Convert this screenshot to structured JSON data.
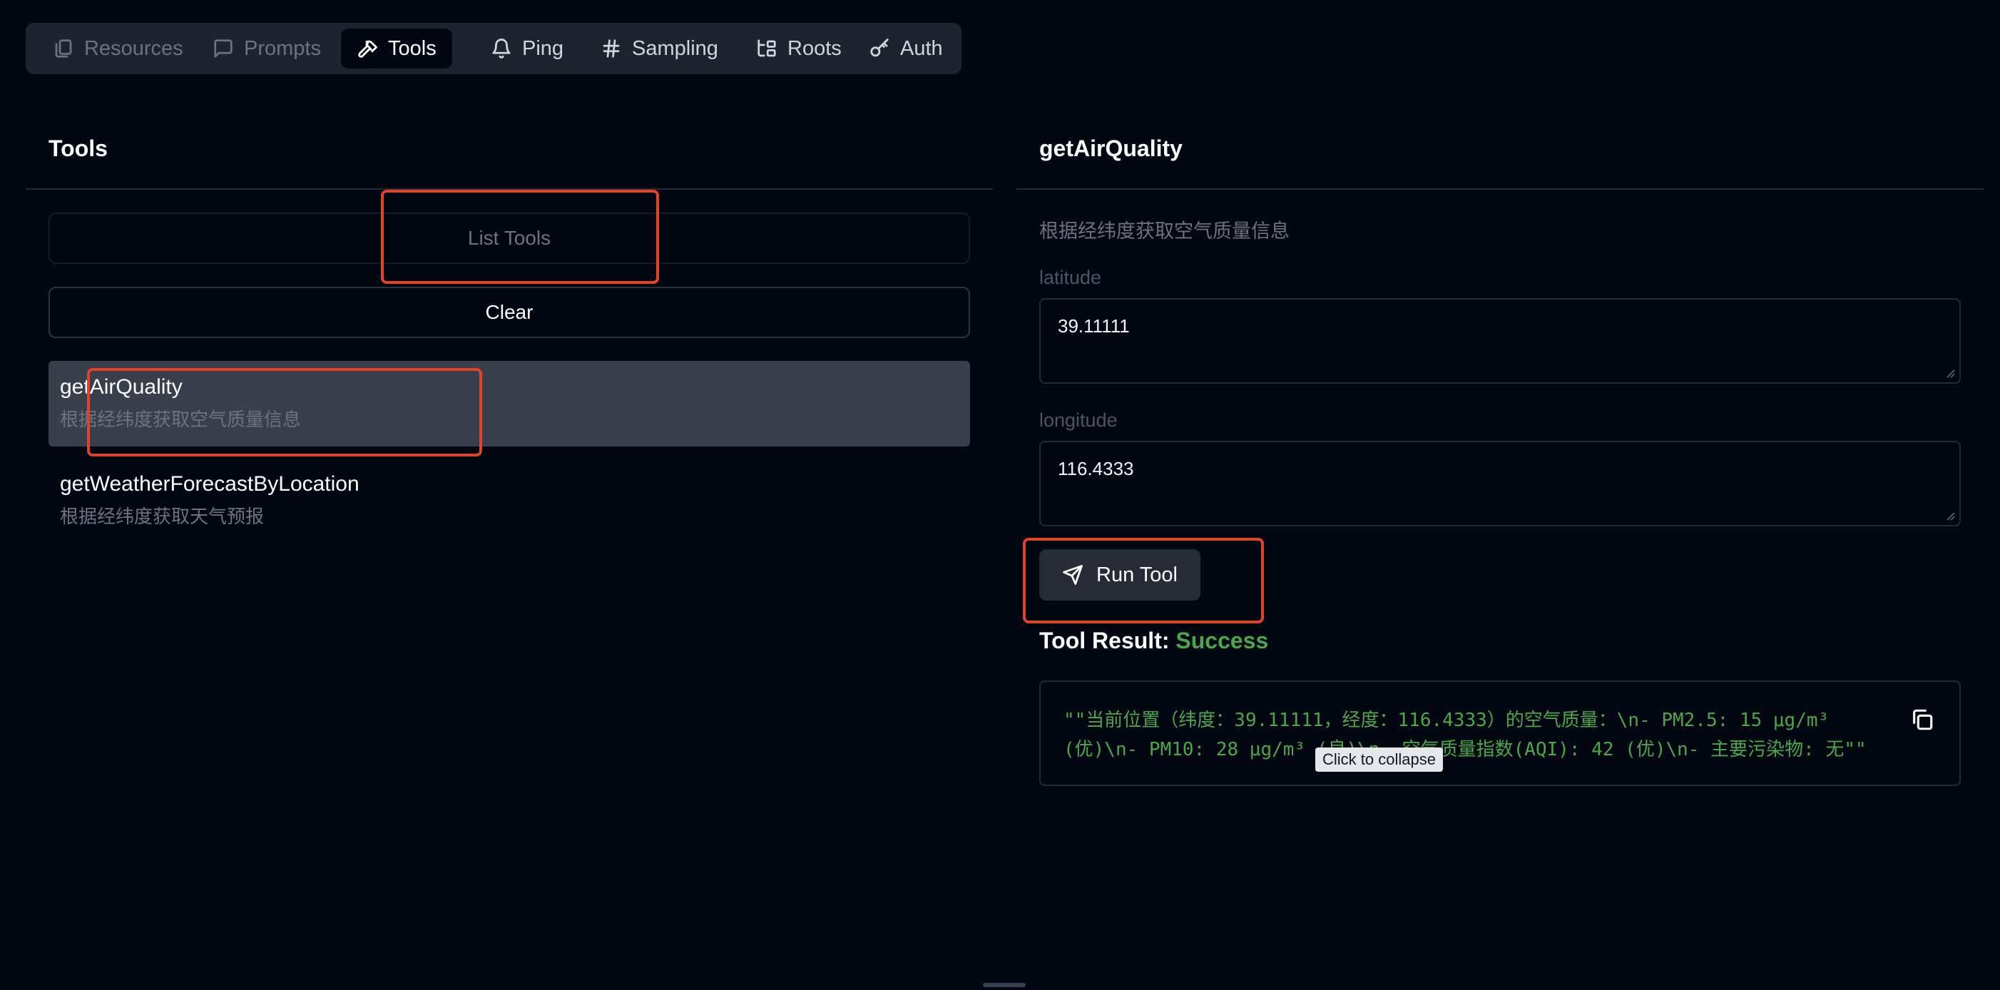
{
  "tabs": [
    {
      "label": "Resources",
      "icon": "files-icon"
    },
    {
      "label": "Prompts",
      "icon": "message-square-icon"
    },
    {
      "label": "Tools",
      "icon": "hammer-icon"
    },
    {
      "label": "Ping",
      "icon": "bell-icon"
    },
    {
      "label": "Sampling",
      "icon": "hash-icon"
    },
    {
      "label": "Roots",
      "icon": "folder-tree-icon"
    },
    {
      "label": "Auth",
      "icon": "key-icon"
    }
  ],
  "active_tab": "Tools",
  "left_panel": {
    "title": "Tools",
    "list_button": "List Tools",
    "clear_button": "Clear",
    "tools": [
      {
        "name": "getAirQuality",
        "description": "根据经纬度获取空气质量信息",
        "selected": true
      },
      {
        "name": "getWeatherForecastByLocation",
        "description": "根据经纬度获取天气预报",
        "selected": false
      }
    ]
  },
  "right_panel": {
    "title": "getAirQuality",
    "description": "根据经纬度获取空气质量信息",
    "fields": [
      {
        "label": "latitude",
        "value": "39.11111"
      },
      {
        "label": "longitude",
        "value": "116.4333"
      }
    ],
    "run_button": "Run Tool",
    "result_label": "Tool Result:",
    "result_status": "Success",
    "result_line1": "\"\"当前位置（纬度：39.11111，经度：116.4333）的空气质量：\\n- PM2.5: 15 μg/m³",
    "result_line2": "(优)\\n- PM10: 28 μg/m³ (良)\\n- 空气质量指数(AQI): 42 (优)\\n- 主要污染物: 无\"\"",
    "tooltip": "Click to collapse"
  },
  "colors": {
    "background": "#030712",
    "success": "#4ca64c",
    "highlight": "#e0432b"
  }
}
